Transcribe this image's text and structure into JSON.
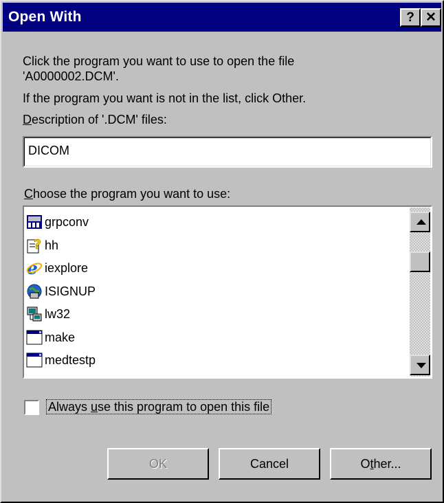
{
  "window": {
    "title": "Open With",
    "help_label": "?",
    "close_label": "✕"
  },
  "intro": {
    "line1": "Click the program you want to use to open the file",
    "line2": "'A0000002.DCM'.",
    "line3": "If the program you want is not in the list, click Other.",
    "desc_label_u": "D",
    "desc_label_rest": "escription of '.DCM' files:"
  },
  "description_field": {
    "value": "DICOM"
  },
  "program_list": {
    "label_u": "C",
    "label_rest": "hoose the program you want to use:",
    "items": [
      {
        "label": "grpconv",
        "icon": "grpconv-icon"
      },
      {
        "label": "hh",
        "icon": "help-file-icon"
      },
      {
        "label": "iexplore",
        "icon": "internet-explorer-icon"
      },
      {
        "label": "ISIGNUP",
        "icon": "isignup-icon"
      },
      {
        "label": "lw32",
        "icon": "lw32-icon"
      },
      {
        "label": "make",
        "icon": "window-app-icon"
      },
      {
        "label": "medtestp",
        "icon": "window-app-icon"
      }
    ]
  },
  "always_use": {
    "checked": false,
    "label_pre": "Always ",
    "label_u": "u",
    "label_post": "se this program to open this file"
  },
  "buttons": {
    "ok": "OK",
    "cancel": "Cancel",
    "other_pre": "O",
    "other_u": "t",
    "other_post": "her..."
  },
  "colors": {
    "titlebar": "#000080",
    "face": "#c0c0c0",
    "disabled_text": "#808080"
  }
}
